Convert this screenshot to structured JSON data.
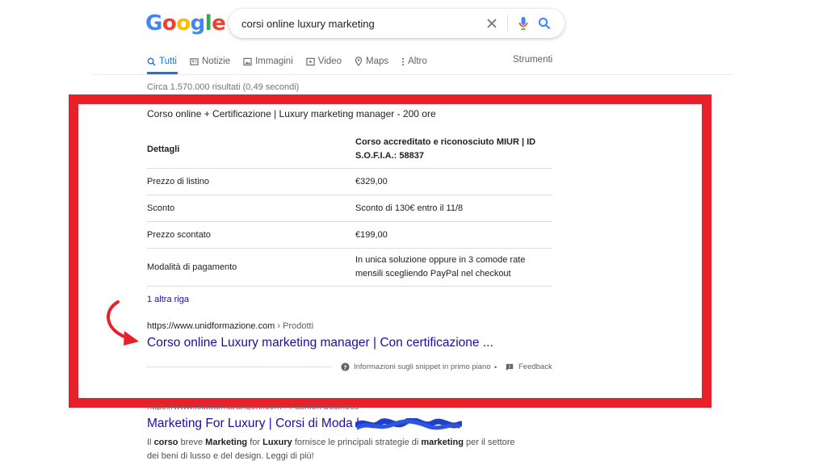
{
  "logo": [
    "G",
    "o",
    "o",
    "g",
    "l",
    "e"
  ],
  "logo_colors": [
    "#4285f4",
    "#ea4335",
    "#fbbc05",
    "#4285f4",
    "#34a853",
    "#ea4335"
  ],
  "search": {
    "query": "corsi online luxury marketing"
  },
  "icons": {
    "clear": "close-icon",
    "voice": "microphone-icon",
    "search": "search-icon"
  },
  "nav": {
    "tabs": [
      {
        "label": "Tutti",
        "icon": "search-icon"
      },
      {
        "label": "Notizie",
        "icon": "news-icon"
      },
      {
        "label": "Immagini",
        "icon": "image-icon"
      },
      {
        "label": "Video",
        "icon": "play-icon"
      },
      {
        "label": "Maps",
        "icon": "map-pin-icon"
      },
      {
        "label": "Altro",
        "icon": "more-vert-icon"
      }
    ],
    "tools": "Strumenti"
  },
  "stats": "Circa 1.570.000 risultati (0,49 secondi)",
  "colors": {
    "accent": "#1a73e8",
    "link": "#1a0dab",
    "frame": "#e8202a"
  },
  "snippet": {
    "title": "Corso online + Certificazione | Luxury marketing manager - 200 ore",
    "table": {
      "header": {
        "left": "Dettagli",
        "right": "Corso accreditato e riconosciuto MIUR | ID S.O.F.I.A.: 58837"
      },
      "rows": [
        {
          "left": "Prezzo di listino",
          "right": "€329,00"
        },
        {
          "left": "Sconto",
          "right": "Sconto di 130€ entro il 11/8"
        },
        {
          "left": "Prezzo scontato",
          "right": "€199,00"
        },
        {
          "left": "Modalità di pagamento",
          "right": "In unica soluzione oppure in 3 comode rate mensili scegliendo PayPal nel checkout"
        }
      ]
    },
    "more_rows": "1 altra riga",
    "url": "https://www.unidformazione.com",
    "breadcrumb": " › Prodotti",
    "link_title": "Corso online Luxury marketing manager | Con certificazione ...",
    "about_snippets": "Informazioni sugli snippet in primo piano",
    "dot": "•",
    "feedback": "Feedback"
  },
  "result2": {
    "url": "https://www.istitutomarangoni.com › Fashion business",
    "title": "Marketing For Luxury | Corsi di Moda |",
    "snippet": [
      {
        "text": "Il ",
        "bold": false
      },
      {
        "text": "corso",
        "bold": true
      },
      {
        "text": " breve ",
        "bold": false
      },
      {
        "text": "Marketing",
        "bold": true
      },
      {
        "text": " for ",
        "bold": false
      },
      {
        "text": "Luxury",
        "bold": true
      },
      {
        "text": " fornisce le principali strategie di ",
        "bold": false
      },
      {
        "text": "marketing",
        "bold": true
      },
      {
        "text": " per il settore dei beni di lusso e del design. Leggi di più!",
        "bold": false
      }
    ]
  }
}
